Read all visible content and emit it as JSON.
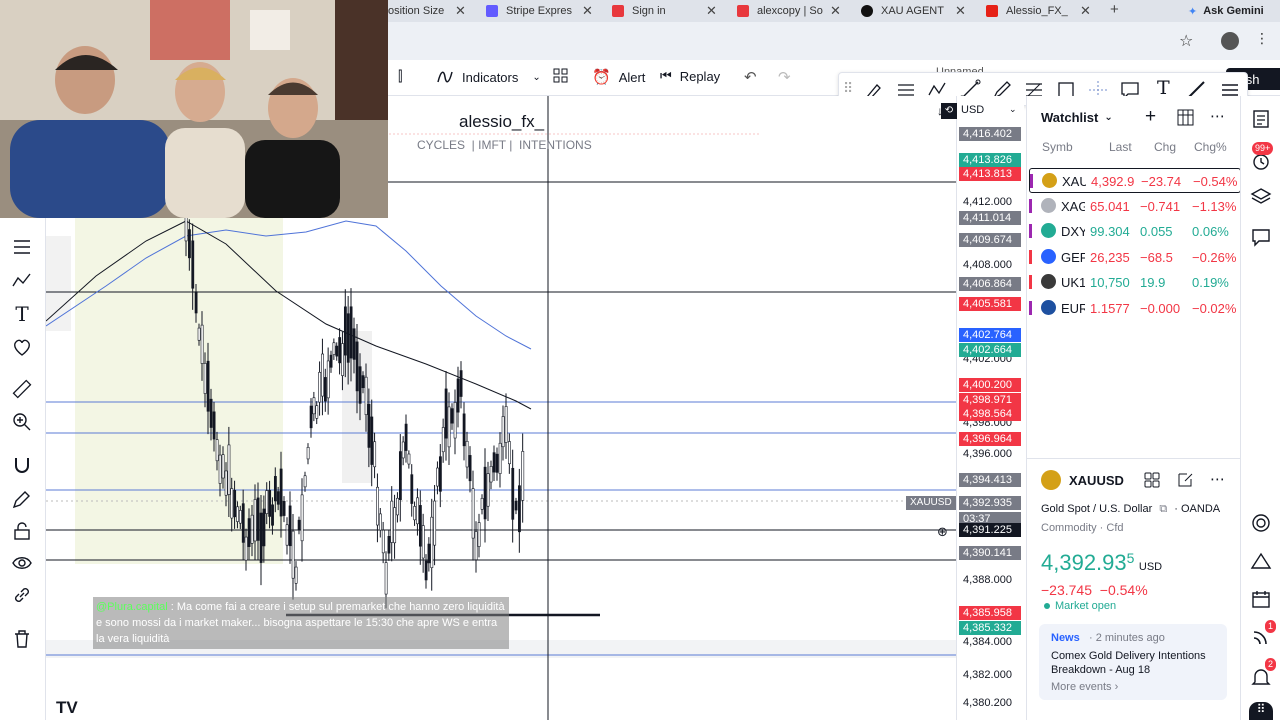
{
  "browser": {
    "tabs": [
      {
        "label": "osition Size",
        "color": "#7b8794"
      },
      {
        "label": "Stripe Expres",
        "color": "#635bff"
      },
      {
        "label": "Sign in",
        "color": "#e8383d"
      },
      {
        "label": "alexcopy | So",
        "color": "#e8383d"
      },
      {
        "label": "XAU AGENT",
        "color": "#111111"
      },
      {
        "label": "Alessio_FX_",
        "color": "#e62117"
      }
    ],
    "new_tab": "+",
    "ask_gemini": "Ask Gemini"
  },
  "toolbar": {
    "indicators": "Indicators",
    "alert": "Alert",
    "replay": "Replay",
    "unnamed": "Unnamed",
    "publish": "lish"
  },
  "chart": {
    "title": "alessio_fx_",
    "subtitle": "CYCLES  | IMFT |  INTENTIONS",
    "symbol_tag": "XAUUSD",
    "countdown": "03:37",
    "crosshair_price": "4,391.225",
    "currency": "USD",
    "logo": "TV",
    "axis_ticks": [
      "4,412.000",
      "4,408.000",
      "4,402.000",
      "4,398.000",
      "4,396.000",
      "4,388.000",
      "4,384.000",
      "4,382.000",
      "4,380.200"
    ],
    "price_labels": [
      {
        "value": "4,416.402",
        "color": "#787b86"
      },
      {
        "value": "4,413.826",
        "color": "#22ab94"
      },
      {
        "value": "4,413.813",
        "color": "#f23645"
      },
      {
        "value": "4,411.014",
        "color": "#787b86"
      },
      {
        "value": "4,409.674",
        "color": "#787b86"
      },
      {
        "value": "4,406.864",
        "color": "#787b86"
      },
      {
        "value": "4,405.581",
        "color": "#f23645"
      },
      {
        "value": "4,402.764",
        "color": "#2962ff"
      },
      {
        "value": "4,402.664",
        "color": "#22ab94"
      },
      {
        "value": "4,400.200",
        "color": "#f23645"
      },
      {
        "value": "4,398.971",
        "color": "#f23645"
      },
      {
        "value": "4,398.564",
        "color": "#f23645"
      },
      {
        "value": "4,396.964",
        "color": "#f23645"
      },
      {
        "value": "4,394.413",
        "color": "#787b86"
      },
      {
        "value": "4,392.935",
        "color": "#787b86"
      },
      {
        "value": "4,390.141",
        "color": "#787b86"
      },
      {
        "value": "4,385.958",
        "color": "#f23645"
      },
      {
        "value": "4,385.332",
        "color": "#22ab94"
      }
    ],
    "overlay_message": {
      "user": "@Plura.capital",
      "text": " : Ma come fai a creare i setup sul premarket che hanno zero liquidità e sono mossi da i market maker... bisogna aspettare le 15:30 che apre WS e entra la vera liquidità"
    }
  },
  "watchlist": {
    "title": "Watchlist",
    "columns": [
      "Symb",
      "Last",
      "Chg",
      "Chg%"
    ],
    "rows": [
      {
        "sym": "XAU",
        "last": "4,392.9",
        "chg": "−23.74",
        "pct": "−0.54%",
        "dir": "neg",
        "icon": "#d4a017",
        "flag": "#9c27b0",
        "icon_name": "gold-icon"
      },
      {
        "sym": "XAG",
        "last": "65.041",
        "chg": "−0.741",
        "pct": "−1.13%",
        "dir": "neg",
        "icon": "#b0b3bb",
        "flag": "#9c27b0",
        "icon_name": "silver-icon"
      },
      {
        "sym": "DXY",
        "last": "99.304",
        "chg": "0.055",
        "pct": "0.06%",
        "dir": "pos",
        "icon": "#22ab94",
        "flag": "#9c27b0",
        "icon_name": "dollar-icon"
      },
      {
        "sym": "GER",
        "last": "26,235",
        "chg": "−68.5",
        "pct": "−0.26%",
        "dir": "neg",
        "icon": "#2962ff",
        "flag": "#f23645",
        "icon_name": "index-icon"
      },
      {
        "sym": "UK1",
        "last": "10,750",
        "chg": "19.9",
        "pct": "0.19%",
        "dir": "pos",
        "icon": "#3a3a3a",
        "flag": "#f23645",
        "icon_name": "ftse-icon"
      },
      {
        "sym": "EUR",
        "last": "1.1577",
        "chg": "−0.000",
        "pct": "−0.02%",
        "dir": "neg",
        "icon": "#1e50a0",
        "flag": "#9c27b0",
        "icon_name": "euro-flag-icon"
      }
    ]
  },
  "details": {
    "symbol": "XAUUSD",
    "name": "Gold Spot / U.S. Dollar",
    "broker": "OANDA",
    "category": "Commodity · Cfd",
    "price_main": "4,392.93",
    "price_small": "5",
    "currency": "USD",
    "change": "−23.745  −0.54%",
    "status": "Market open",
    "news_tag": "News",
    "news_time": "· 2 minutes ago",
    "news_title": "Comex Gold Delivery Intentions Breakdown - Aug 18",
    "more_events": "More events ›"
  },
  "badges": {
    "alerts": "99+",
    "ideas": "1",
    "notifications": "2"
  }
}
